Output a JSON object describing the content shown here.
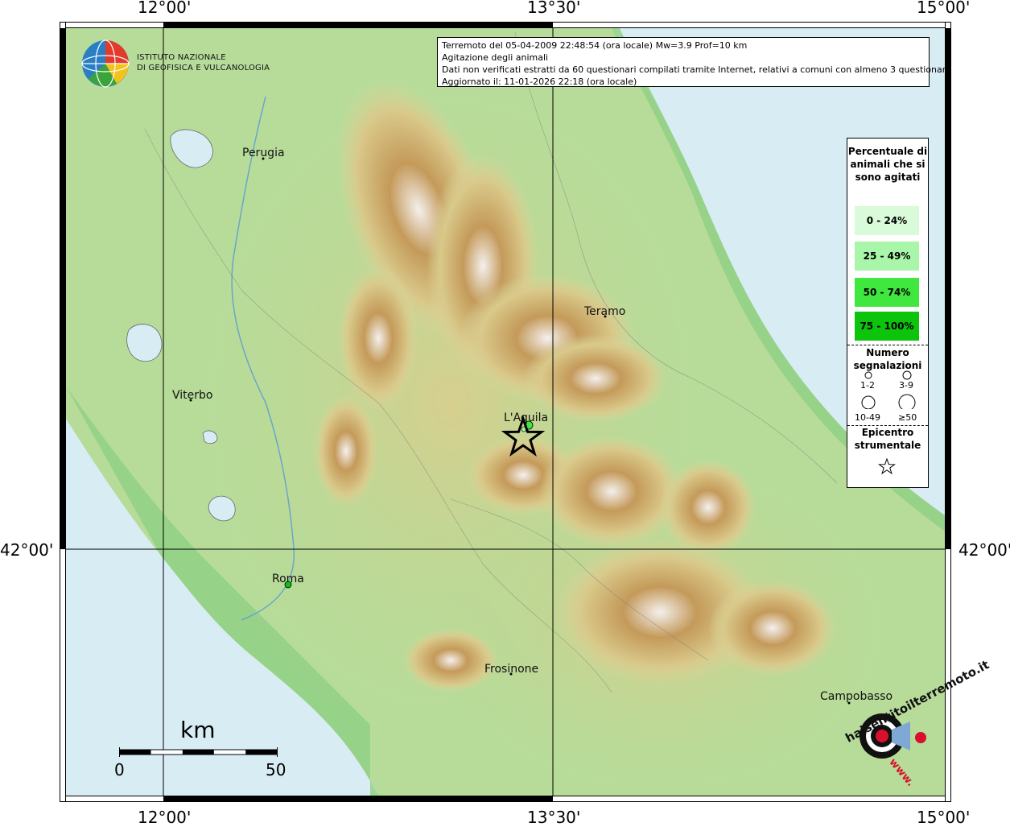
{
  "header": {
    "lines": [
      "Terremoto del 05-04-2009 22:48:54 (ora locale) Mw=3.9 Prof=10 km",
      "Agitazione degli animali",
      "Dati non verificati estratti da 60 questionari compilati tramite Internet, relativi a comuni con almeno 3 questionari.",
      "Aggiornato il: 11-01-2026 22:18 (ora locale)"
    ]
  },
  "logo": {
    "line1": "ISTITUTO NAZIONALE",
    "line2": "DI GEOFISICA E VULCANOLOGIA"
  },
  "coords": {
    "top": [
      "12°00'",
      "13°30'",
      "15°00'"
    ],
    "bottom": [
      "12°00'",
      "13°30'",
      "15°00'"
    ],
    "left": "42°00'",
    "right": "42°00'"
  },
  "cities": [
    {
      "name": "Perugia"
    },
    {
      "name": "Teramo"
    },
    {
      "name": "Viterbo"
    },
    {
      "name": "L'Aquila"
    },
    {
      "name": "Roma"
    },
    {
      "name": "Frosinone"
    },
    {
      "name": "Campobasso"
    }
  ],
  "legend": {
    "title": "Percentuale di animali che si sono agitati",
    "classes": [
      {
        "label": "0 - 24%",
        "color": "#d9fbd9"
      },
      {
        "label": "25 - 49%",
        "color": "#a9f5a9"
      },
      {
        "label": "50 - 74%",
        "color": "#3fe73f"
      },
      {
        "label": "75 - 100%",
        "color": "#0dc40d"
      }
    ],
    "count_title": "Numero segnalazioni",
    "counts": [
      "1-2",
      "3-9",
      "10-49",
      "≥50"
    ],
    "epicenter_title": "Epicentro strumentale"
  },
  "scale": {
    "unit": "km",
    "min": "0",
    "max": "50"
  },
  "watermark": {
    "text": "haisentitoilterremoto.it",
    "url": "www."
  },
  "colors": {
    "sea": "#d8ecf4",
    "lowland": "#9ed38f",
    "hills": "#d9d69a",
    "mountains": "#c49a5a",
    "peaks": "#f4f0ee"
  }
}
